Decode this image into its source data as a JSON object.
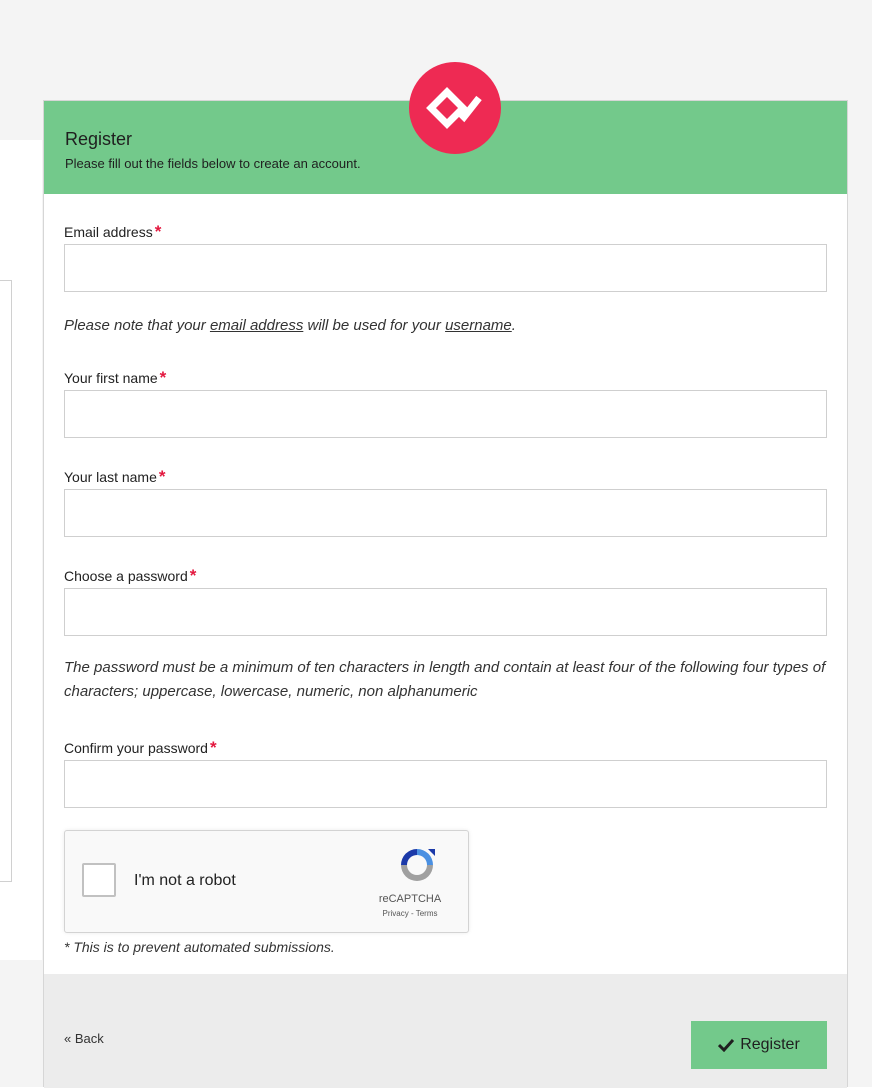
{
  "header": {
    "title": "Register",
    "subtitle": "Please fill out the fields below to create an account.",
    "logo_icon": "brand-logo-icon",
    "accent_color": "#73c98b",
    "logo_color": "#ee2a53"
  },
  "form": {
    "required_marker": "*",
    "email": {
      "label": "Email address",
      "value": "",
      "placeholder": ""
    },
    "email_note": {
      "prefix": "Please note that your ",
      "link1": "email address",
      "middle": " will be used for your ",
      "link2": "username",
      "suffix": "."
    },
    "first_name": {
      "label": "Your first name",
      "value": "",
      "placeholder": ""
    },
    "last_name": {
      "label": "Your last name",
      "value": "",
      "placeholder": ""
    },
    "password": {
      "label": "Choose a password",
      "value": "",
      "placeholder": ""
    },
    "password_note": "The password must be a minimum of ten characters in length and contain at least four of the following four types of characters; uppercase, lowercase, numeric, non alphanumeric",
    "confirm_password": {
      "label": "Confirm your password",
      "value": "",
      "placeholder": ""
    },
    "recaptcha": {
      "label": "I'm not a robot",
      "brand": "reCAPTCHA",
      "terms": "Privacy - Terms",
      "checked": false
    },
    "prevent_note": "* This is to prevent automated submissions."
  },
  "footer": {
    "back_label": "« Back",
    "register_label": "Register",
    "register_icon": "checkmark-icon"
  }
}
